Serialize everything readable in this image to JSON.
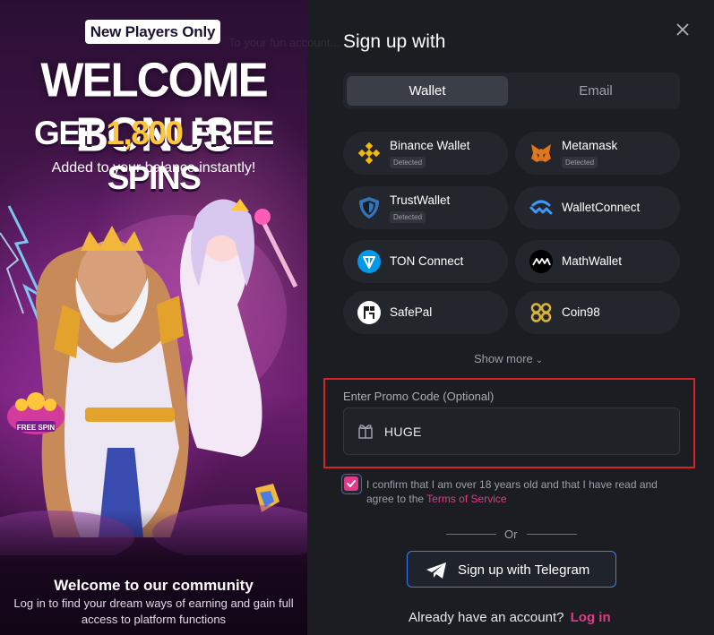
{
  "promo": {
    "badge": "New Players Only",
    "headline": "WELCOME BONUS",
    "subheadline_prefix": "GET ",
    "subheadline_amount": "1,800",
    "subheadline_suffix": " FREE SPINS",
    "tagline": "Added to your balance instantly!",
    "spin_badge": "FREE SPIN",
    "community_title": "Welcome to our community",
    "community_desc": "Log in to find your dream ways of earning and gain full access to platform functions"
  },
  "form": {
    "title": "Sign up with",
    "ghost_text": "To your fun account...",
    "tabs": [
      {
        "label": "Wallet",
        "active": true
      },
      {
        "label": "Email",
        "active": false
      }
    ],
    "wallets": [
      {
        "name": "Binance Wallet",
        "detected": "Detected",
        "icon": "binance-icon"
      },
      {
        "name": "Metamask",
        "detected": "Detected",
        "icon": "metamask-icon"
      },
      {
        "name": "TrustWallet",
        "detected": "Detected",
        "icon": "trustwallet-icon"
      },
      {
        "name": "WalletConnect",
        "detected": "",
        "icon": "walletconnect-icon"
      },
      {
        "name": "TON Connect",
        "detected": "",
        "icon": "ton-icon"
      },
      {
        "name": "MathWallet",
        "detected": "",
        "icon": "mathwallet-icon"
      },
      {
        "name": "SafePal",
        "detected": "",
        "icon": "safepal-icon"
      },
      {
        "name": "Coin98",
        "detected": "",
        "icon": "coin98-icon"
      }
    ],
    "show_more": "Show more",
    "promo_label": "Enter Promo Code (Optional)",
    "promo_value": "HUGE",
    "confirm_text": "I confirm that I am over 18 years old and that I have read and agree to the ",
    "terms_link": "Terms of Service",
    "confirm_checked": true,
    "or_text": "Or",
    "telegram_button": "Sign up with Telegram",
    "already_text": "Already have an account?",
    "login_link": "Log in"
  },
  "colors": {
    "accent_pink": "#e03b8a",
    "telegram_blue": "#3c7ff2",
    "highlight_red": "#d8222b",
    "gold": "#ffc63a"
  }
}
